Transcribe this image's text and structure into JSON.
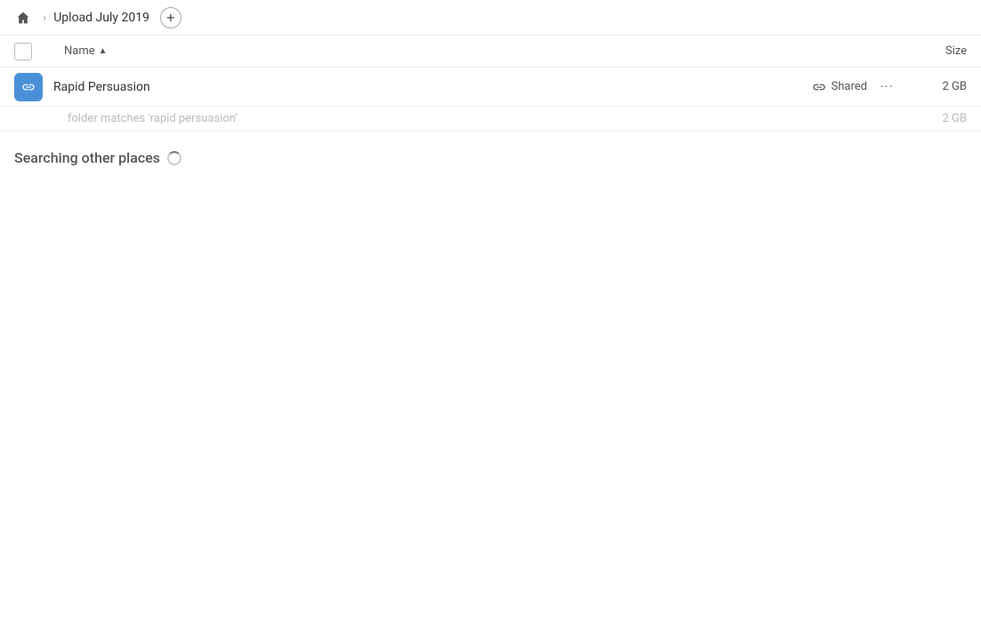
{
  "topbar": {
    "home_label": "Home",
    "breadcrumb_title": "Upload July 2019",
    "add_button_label": "+"
  },
  "columns": {
    "name_label": "Name",
    "name_sort_indicator": "▲",
    "size_label": "Size"
  },
  "file_row": {
    "name": "Rapid Persuasion",
    "shared_label": "Shared",
    "more_label": "···",
    "size": "2 GB",
    "folder_match_text": "folder matches 'rapid persuasion'",
    "folder_match_size": "2 GB"
  },
  "search_status": {
    "text": "Searching other places"
  }
}
